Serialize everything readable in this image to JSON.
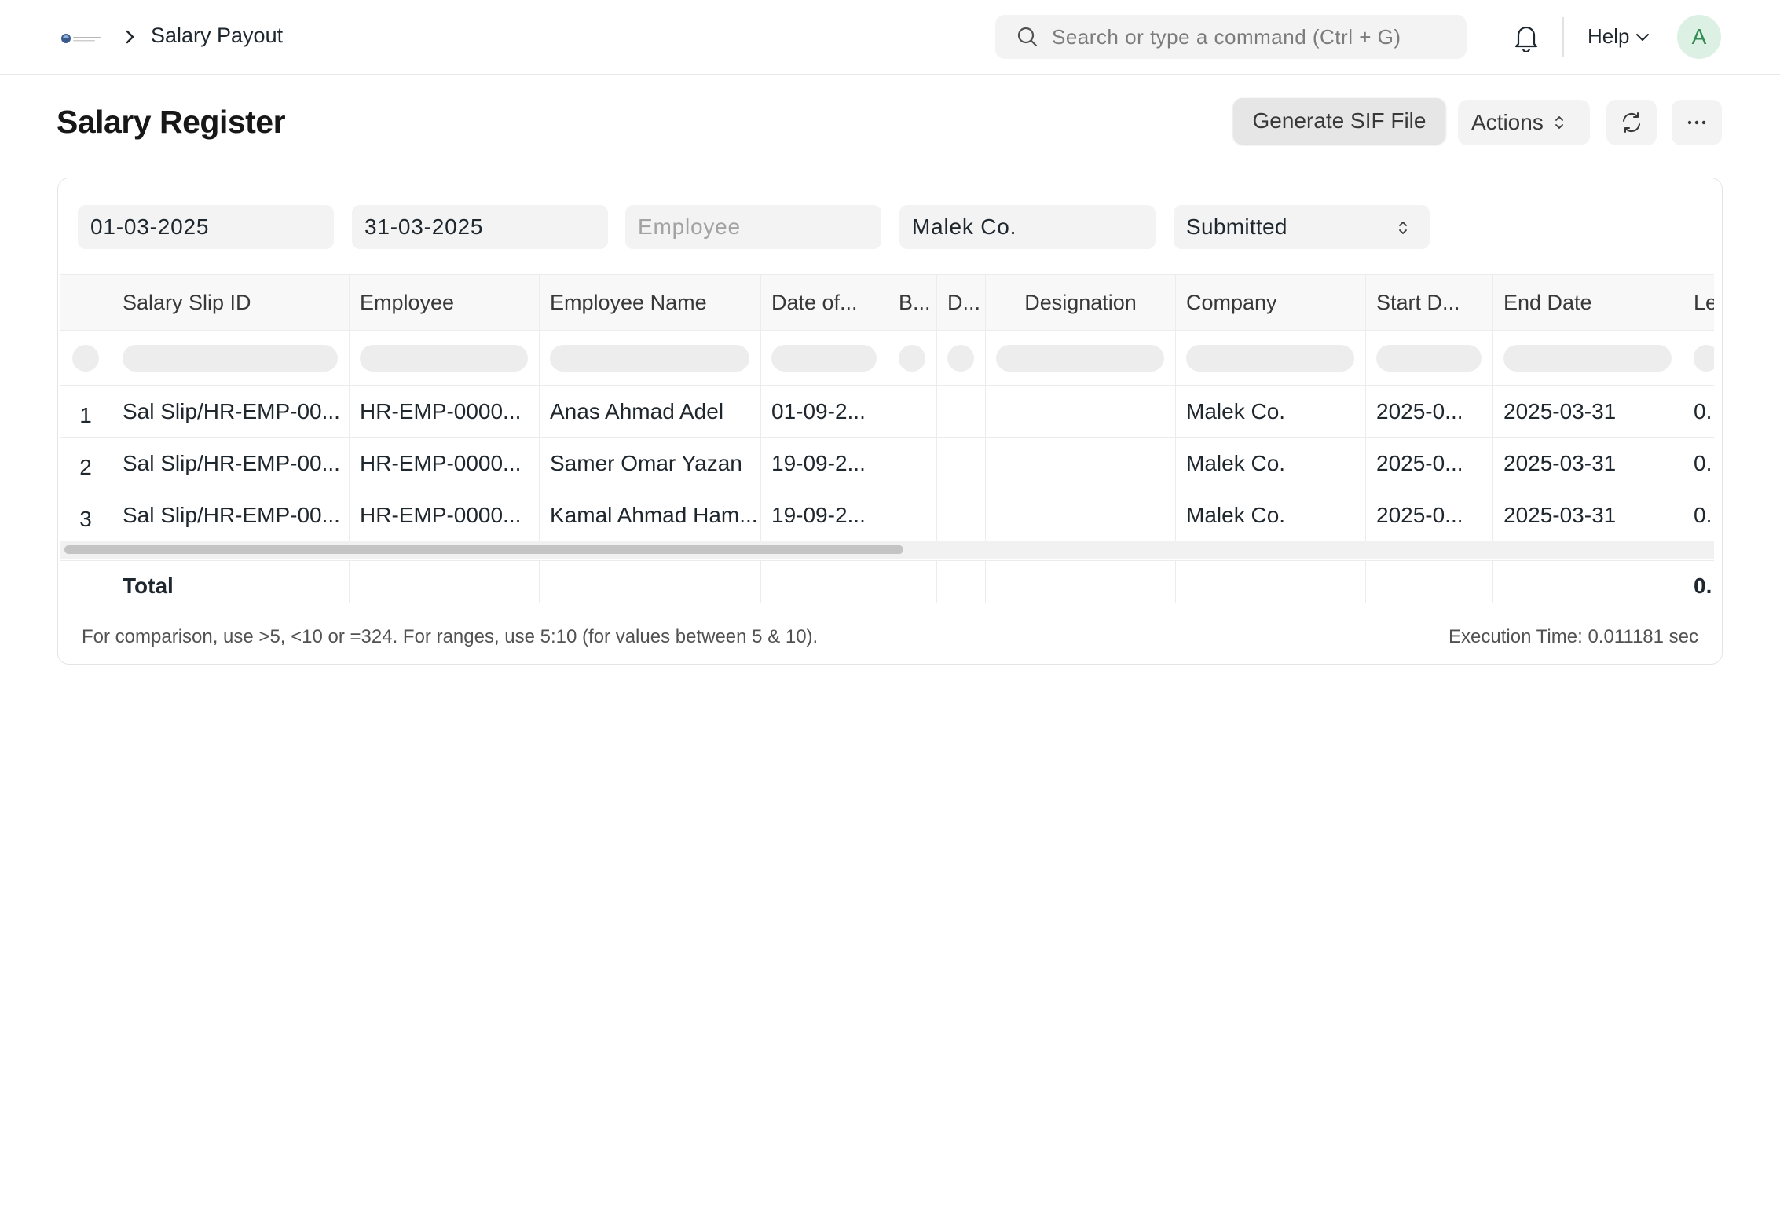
{
  "navbar": {
    "breadcrumb": "Salary Payout",
    "search_placeholder": "Search or type a command (Ctrl + G)",
    "help_label": "Help",
    "avatar_initial": "A"
  },
  "page": {
    "title": "Salary Register",
    "generate_sif_label": "Generate SIF File",
    "actions_label": "Actions"
  },
  "filters": {
    "from_date": "01-03-2025",
    "to_date": "31-03-2025",
    "employee_placeholder": "Employee",
    "company": "Malek Co.",
    "docstatus": "Submitted"
  },
  "table": {
    "columns": [
      "Salary Slip ID",
      "Employee",
      "Employee Name",
      "Date of...",
      "B...",
      "D...",
      "Designation",
      "Company",
      "Start D...",
      "End Date",
      "Le"
    ],
    "rows": [
      {
        "index": "1",
        "cells": [
          "Sal Slip/HR-EMP-00...",
          "HR-EMP-0000...",
          "Anas Ahmad Adel",
          "01-09-2...",
          "",
          "",
          "",
          "Malek Co.",
          "2025-0...",
          "2025-03-31",
          "0."
        ]
      },
      {
        "index": "2",
        "cells": [
          "Sal Slip/HR-EMP-00...",
          "HR-EMP-0000...",
          "Samer Omar Yazan",
          "19-09-2...",
          "",
          "",
          "",
          "Malek Co.",
          "2025-0...",
          "2025-03-31",
          "0."
        ]
      },
      {
        "index": "3",
        "cells": [
          "Sal Slip/HR-EMP-00...",
          "HR-EMP-0000...",
          "Kamal Ahmad Ham...",
          "19-09-2...",
          "",
          "",
          "",
          "Malek Co.",
          "2025-0...",
          "2025-03-31",
          "0."
        ]
      }
    ],
    "total_label": "Total",
    "total_last": "0."
  },
  "footer": {
    "hint": "For comparison, use >5, <10 or =324. For ranges, use 5:10 (for values between 5 & 10).",
    "execution_time": "Execution Time: 0.011181 sec"
  },
  "icons": {
    "breadcrumb": "chevron-right-icon",
    "search": "search-icon",
    "notifications": "bell-icon",
    "help": "chevron-down-icon",
    "actions": "updown-icon",
    "refresh": "refresh-icon",
    "more": "more-icon"
  },
  "colors": {
    "avatar_bg": "#dcf1e4",
    "avatar_text": "#2f8a53",
    "control_bg": "#f3f3f3"
  }
}
